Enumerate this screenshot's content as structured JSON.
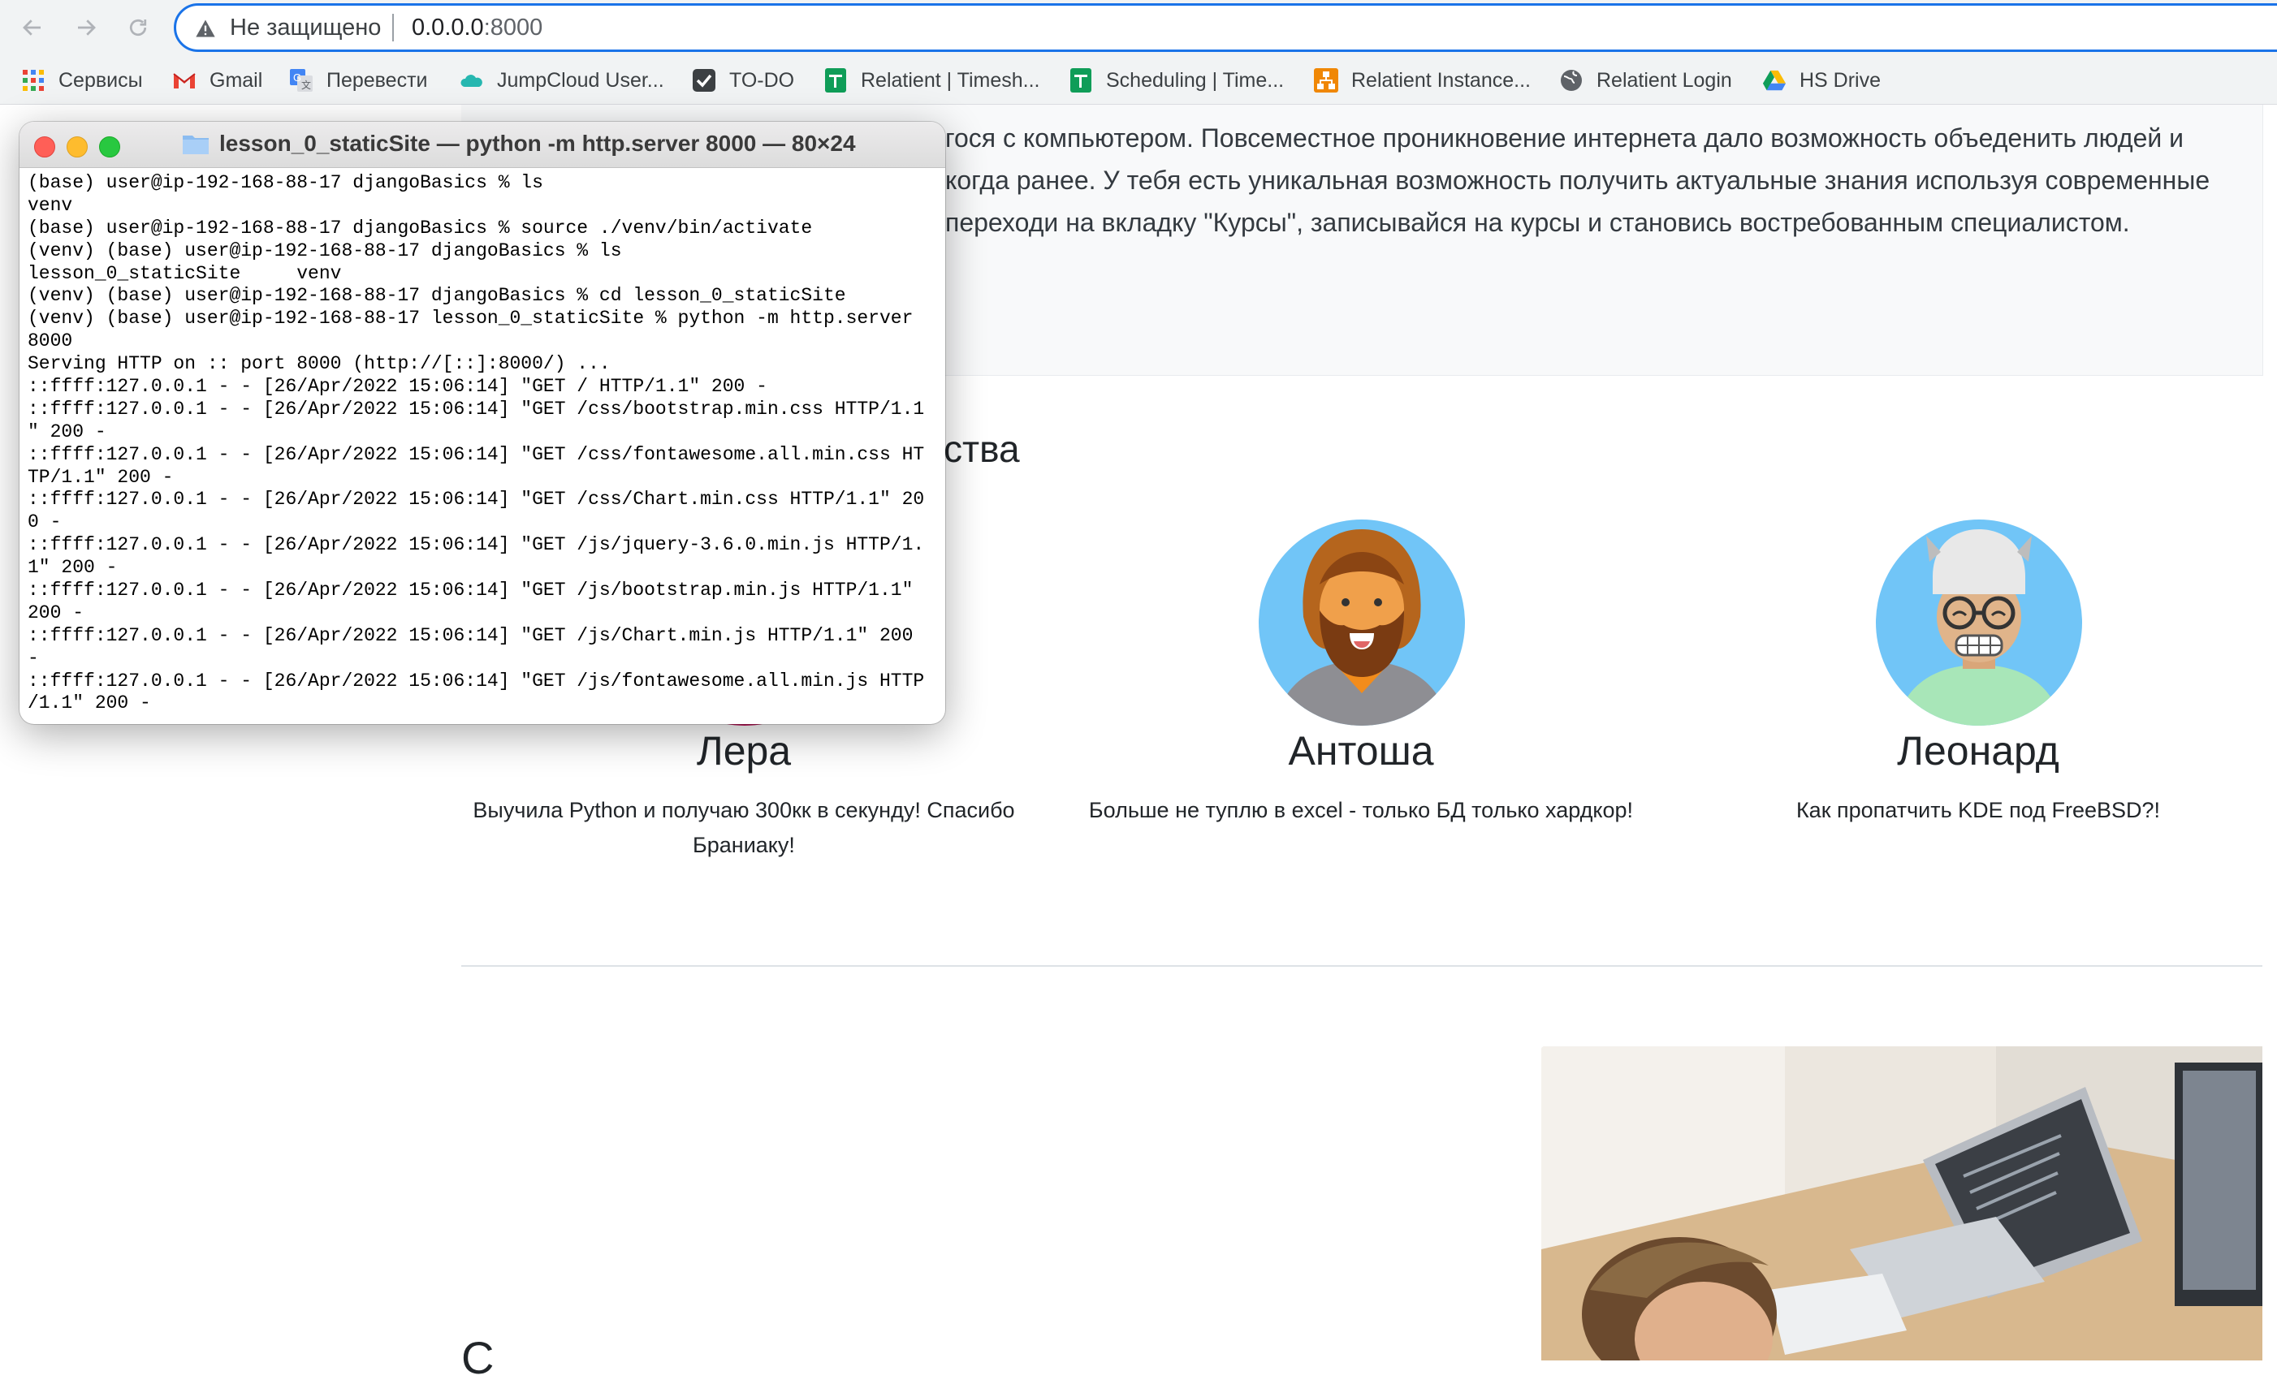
{
  "browser": {
    "insecure_label": "Не защищено",
    "url_host": "0.0.0.0",
    "url_port": ":8000",
    "bookmarks": [
      {
        "label": "Сервисы",
        "icon": "apps-grid-icon"
      },
      {
        "label": "Gmail",
        "icon": "gmail-icon"
      },
      {
        "label": "Перевести",
        "icon": "translate-icon"
      },
      {
        "label": "JumpCloud User...",
        "icon": "jumpcloud-icon"
      },
      {
        "label": "TO-DO",
        "icon": "checkbox-icon"
      },
      {
        "label": "Relatient | Timesh...",
        "icon": "sheets-icon"
      },
      {
        "label": "Scheduling | Time...",
        "icon": "sheets-icon"
      },
      {
        "label": "Relatient Instance...",
        "icon": "diagram-icon"
      },
      {
        "label": "Relatient Login",
        "icon": "globe-icon"
      },
      {
        "label": "HS Drive",
        "icon": "drive-icon"
      }
    ]
  },
  "page": {
    "intro_lines": [
      "гося с компьютером. Повсеместное проникновение интернета дало возможность объеденить людей и",
      "когда ранее. У тебя есть уникальная возможность получить актуальные знания используя современные",
      "переходи на вкладку \"Курсы\", записывайся на курсы и становись востребованным специалистом."
    ],
    "partial_heading": "ства",
    "people": [
      {
        "name": "Лера",
        "quote": "Выучила Python и получаю 300кк в секунду! Спасибо Браниаку!"
      },
      {
        "name": "Антоша",
        "quote": "Больше не туплю в excel - только БД только хардкор!"
      },
      {
        "name": "Леонард",
        "quote": "Как пропатчить KDE под FreeBSD?!"
      }
    ],
    "bottom_heading_partial": "С"
  },
  "terminal": {
    "title": "lesson_0_staticSite — python -m http.server 8000 — 80×24",
    "lines": [
      "(base) user@ip-192-168-88-17 djangoBasics % ls",
      "venv",
      "(base) user@ip-192-168-88-17 djangoBasics % source ./venv/bin/activate",
      "(venv) (base) user@ip-192-168-88-17 djangoBasics % ls",
      "lesson_0_staticSite     venv",
      "(venv) (base) user@ip-192-168-88-17 djangoBasics % cd lesson_0_staticSite",
      "(venv) (base) user@ip-192-168-88-17 lesson_0_staticSite % python -m http.server",
      "8000",
      "Serving HTTP on :: port 8000 (http://[::]:8000/) ...",
      "::ffff:127.0.0.1 - - [26/Apr/2022 15:06:14] \"GET / HTTP/1.1\" 200 -",
      "::ffff:127.0.0.1 - - [26/Apr/2022 15:06:14] \"GET /css/bootstrap.min.css HTTP/1.1",
      "\" 200 -",
      "::ffff:127.0.0.1 - - [26/Apr/2022 15:06:14] \"GET /css/fontawesome.all.min.css HT",
      "TP/1.1\" 200 -",
      "::ffff:127.0.0.1 - - [26/Apr/2022 15:06:14] \"GET /css/Chart.min.css HTTP/1.1\" 20",
      "0 -",
      "::ffff:127.0.0.1 - - [26/Apr/2022 15:06:14] \"GET /js/jquery-3.6.0.min.js HTTP/1.",
      "1\" 200 -",
      "::ffff:127.0.0.1 - - [26/Apr/2022 15:06:14] \"GET /js/bootstrap.min.js HTTP/1.1\"",
      "200 -",
      "::ffff:127.0.0.1 - - [26/Apr/2022 15:06:14] \"GET /js/Chart.min.js HTTP/1.1\" 200",
      "-",
      "::ffff:127.0.0.1 - - [26/Apr/2022 15:06:14] \"GET /js/fontawesome.all.min.js HTTP",
      "/1.1\" 200 -"
    ]
  }
}
